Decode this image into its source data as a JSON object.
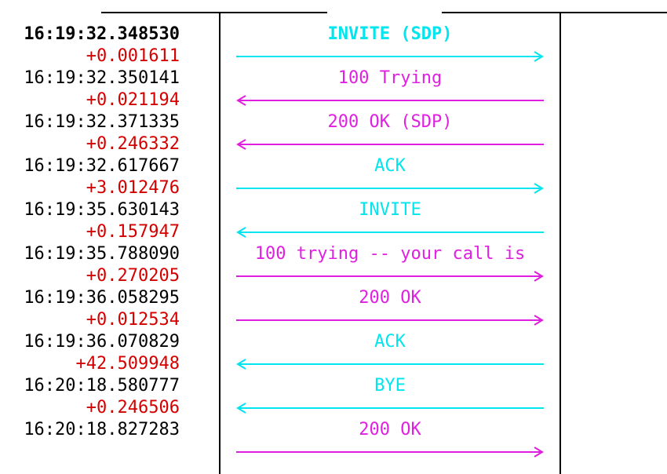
{
  "colors": {
    "cyan": "#00e5ee",
    "magenta": "#e020e0",
    "delta_red": "#d40000",
    "lines": "#000000"
  },
  "flow": [
    {
      "time": "16:19:32.348530",
      "delta": "+0.001611",
      "label": "INVITE (SDP)",
      "direction": "right",
      "color": "cyan"
    },
    {
      "time": "16:19:32.350141",
      "delta": "+0.021194",
      "label": "100 Trying",
      "direction": "left",
      "color": "magenta"
    },
    {
      "time": "16:19:32.371335",
      "delta": "+0.246332",
      "label": "200 OK (SDP)",
      "direction": "left",
      "color": "magenta"
    },
    {
      "time": "16:19:32.617667",
      "delta": "+3.012476",
      "label": "ACK",
      "direction": "right",
      "color": "cyan"
    },
    {
      "time": "16:19:35.630143",
      "delta": "+0.157947",
      "label": "INVITE",
      "direction": "left",
      "color": "cyan"
    },
    {
      "time": "16:19:35.788090",
      "delta": "+0.270205",
      "label": "100 trying -- your call is",
      "direction": "right",
      "color": "magenta"
    },
    {
      "time": "16:19:36.058295",
      "delta": "+0.012534",
      "label": "200 OK",
      "direction": "right",
      "color": "magenta"
    },
    {
      "time": "16:19:36.070829",
      "delta": "+42.509948",
      "label": "ACK",
      "direction": "left",
      "color": "cyan"
    },
    {
      "time": "16:20:18.580777",
      "delta": "+0.246506",
      "label": "BYE",
      "direction": "left",
      "color": "cyan"
    },
    {
      "time": "16:20:18.827283",
      "delta": "",
      "label": "200 OK",
      "direction": "right",
      "color": "magenta"
    }
  ]
}
